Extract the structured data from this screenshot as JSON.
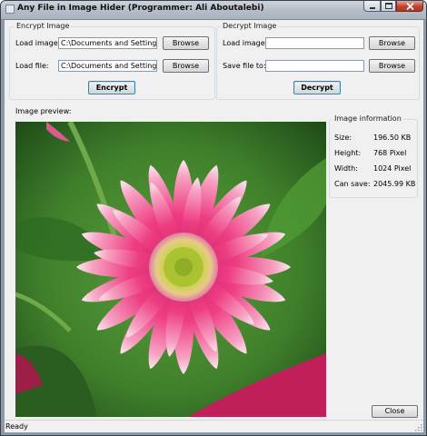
{
  "window": {
    "title": "Any File in Image Hider (Programmer: Ali Aboutalebi)",
    "icon": "app-icon",
    "controls": {
      "minimize": "minimize-icon",
      "maximize": "maximize-icon",
      "close": "close-icon",
      "close_color": "#c0442d"
    }
  },
  "encrypt": {
    "group_label": "Encrypt Image",
    "load_image_label": "Load image:",
    "load_image_value": "C:\\Documents and Settings\\Ad",
    "load_image_browse": "Browse",
    "load_file_label": "Load file:",
    "load_file_value": "C:\\Documents and Settings\\Ad",
    "load_file_browse": "Browse",
    "action": "Encrypt"
  },
  "decrypt": {
    "group_label": "Decrypt Image",
    "load_image_label": "Load image:",
    "load_image_value": "",
    "load_image_browse": "Browse",
    "save_file_label": "Save file to:",
    "save_file_value": "",
    "save_file_browse": "Browse",
    "action": "Decrypt"
  },
  "preview": {
    "label": "Image preview:",
    "subject": "pink gerbera daisy on green leaves",
    "colors": {
      "petal": "#ee3d82",
      "petal_tip": "#fce6ef",
      "center": "#b7c53a",
      "leaves": "#3d7a2a",
      "accent_leaf": "#c01f5a"
    }
  },
  "info": {
    "group_label": "Image information",
    "rows": [
      {
        "label": "Size:",
        "value": "196.50 KB"
      },
      {
        "label": "Height:",
        "value": "768 Pixel"
      },
      {
        "label": "Width:",
        "value": "1024 Pixel"
      },
      {
        "label": "Can save:",
        "value": "2045.99 KB"
      }
    ]
  },
  "close_button": "Close",
  "status": "Ready"
}
